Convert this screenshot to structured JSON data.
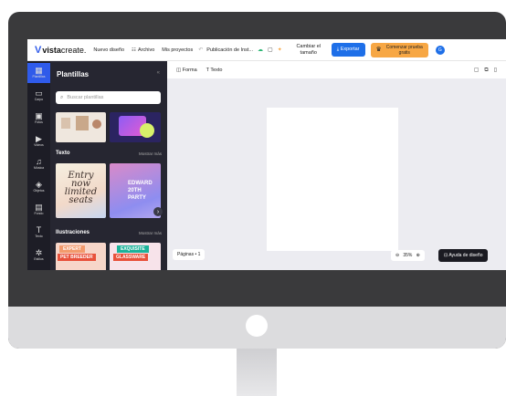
{
  "topbar": {
    "logo_mark": "V",
    "logo_bold": "vista",
    "logo_light": "create.",
    "nav_new_design": "Nuevo diseño",
    "nav_file": "Archivo",
    "nav_my_projects": "Mis proyectos",
    "doc_name": "Publicación de Inst...",
    "resize_line1": "Cambiar el",
    "resize_line2": "tamaño",
    "export_label": "Exportar",
    "trial_line1": "Comenzar prueba",
    "trial_line2": "gratis",
    "avatar_initial": "G"
  },
  "rail": {
    "items": [
      {
        "label": "Plantillas",
        "icon": "grid-icon"
      },
      {
        "label": "Carpo",
        "icon": "folder-icon"
      },
      {
        "label": "Fotos",
        "icon": "photo-icon"
      },
      {
        "label": "Videos",
        "icon": "video-icon"
      },
      {
        "label": "Música",
        "icon": "music-icon"
      },
      {
        "label": "Objetos",
        "icon": "shapes-icon"
      },
      {
        "label": "Fondo",
        "icon": "background-icon"
      },
      {
        "label": "Texto",
        "icon": "text-icon"
      },
      {
        "label": "Estilos",
        "icon": "styles-icon"
      }
    ]
  },
  "panel": {
    "title": "Plantillas",
    "search_placeholder": "Buscar plantillas",
    "sections": [
      {
        "title": "Texto",
        "more": "Mostrar más"
      },
      {
        "title": "Ilustraciones",
        "more": "Mostrar más"
      }
    ],
    "cards": {
      "text1_line1": "Entry",
      "text1_line2": "now",
      "text1_line3": "limited",
      "text1_line4": "seats",
      "text2_line1": "EDWARD",
      "text2_line2": "20TH PARTY",
      "ill1_top": "EXPERT",
      "ill1_bottom": "PET BREEDER",
      "ill2_top": "EXQUISITE",
      "ill2_bottom": "GLASSWARE"
    }
  },
  "workspace": {
    "tool_shape": "Forma",
    "tool_text": "Texto",
    "pages_label": "Páginas • 1",
    "zoom_value": "35%",
    "help_label": "Ayuda de diseño"
  },
  "colors": {
    "accent": "#2f5bea",
    "export": "#1e6fe8",
    "trial": "#f7a744",
    "panel_bg": "#262631",
    "rail_bg": "#1d1d26"
  }
}
